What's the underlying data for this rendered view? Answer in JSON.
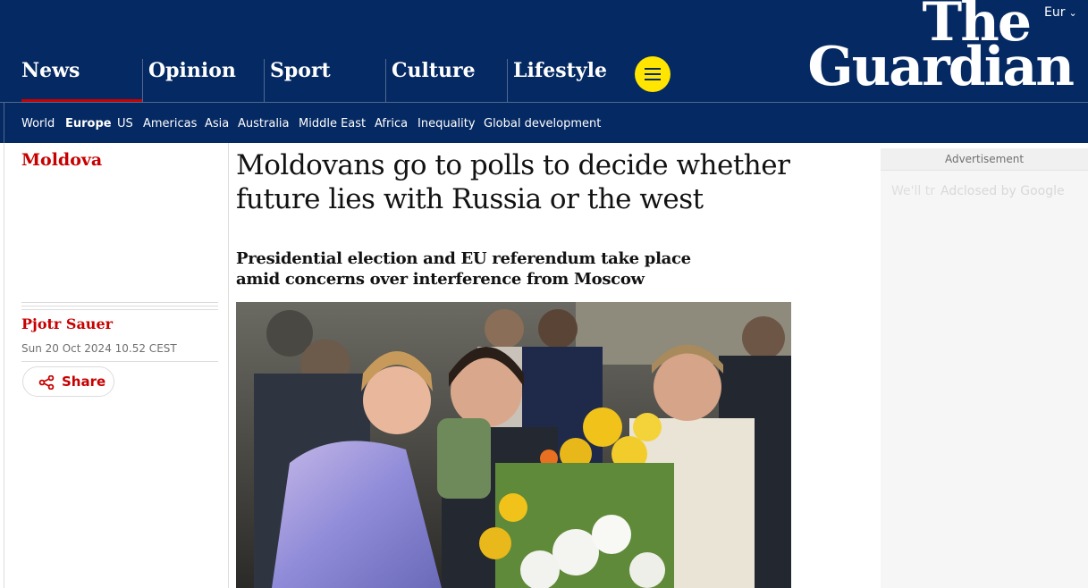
{
  "header": {
    "edition": "Eur",
    "logo_line1": "The",
    "logo_line2": "Guardian",
    "pillars": [
      "News",
      "Opinion",
      "Sport",
      "Culture",
      "Lifestyle"
    ],
    "subnav": [
      "World",
      "Europe",
      "US",
      "Americas",
      "Asia",
      "Australia",
      "Middle East",
      "Africa",
      "Inequality",
      "Global development"
    ],
    "active_subnav": "Europe",
    "colors": {
      "brand": "#052962",
      "accent": "#c70000",
      "menu": "#ffe500"
    }
  },
  "article": {
    "kicker": "Moldova",
    "headline": "Moldovans go to polls to decide whether future lies with Russia or the west",
    "standfirst": "Presidential election and EU referendum take place amid concerns over interference from Moscow",
    "byline": "Pjotr Sauer",
    "dateline": "Sun 20 Oct 2024 10.52 CEST",
    "share_label": "Share",
    "share_icon": "share-icon"
  },
  "ad": {
    "label": "Advertisement",
    "placeholder": "We'll tr",
    "overlay": "Adclosed by Google"
  }
}
